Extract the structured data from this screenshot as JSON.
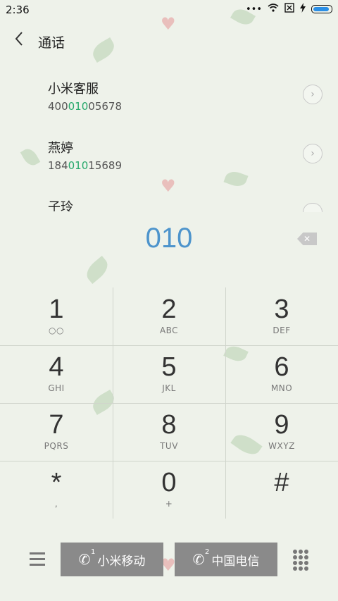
{
  "status_bar": {
    "time": "2:36",
    "signal_dots": "•••"
  },
  "header": {
    "title": "通话"
  },
  "contacts": [
    {
      "name": "小米客服",
      "num_pre": "400",
      "num_hl": "010",
      "num_post": "05678"
    },
    {
      "name": "燕婷",
      "num_pre": "184",
      "num_hl": "010",
      "num_post": "15689"
    },
    {
      "name": "子玲"
    }
  ],
  "dial_input": "010",
  "keypad": [
    {
      "digit": "1",
      "letters": "○○"
    },
    {
      "digit": "2",
      "letters": "ABC"
    },
    {
      "digit": "3",
      "letters": "DEF"
    },
    {
      "digit": "4",
      "letters": "GHI"
    },
    {
      "digit": "5",
      "letters": "JKL"
    },
    {
      "digit": "6",
      "letters": "MNO"
    },
    {
      "digit": "7",
      "letters": "PQRS"
    },
    {
      "digit": "8",
      "letters": "TUV"
    },
    {
      "digit": "9",
      "letters": "WXYZ"
    },
    {
      "digit": "*",
      "letters": ","
    },
    {
      "digit": "0",
      "letters": "+"
    },
    {
      "digit": "#",
      "letters": ""
    }
  ],
  "bottom_bar": {
    "sim1": {
      "label": "小米移动",
      "slot": "1"
    },
    "sim2": {
      "label": "中国电信",
      "slot": "2"
    }
  },
  "colors": {
    "accent": "#4d94cc",
    "highlight": "#26a86b",
    "sim_button": "#8a8a8a"
  }
}
